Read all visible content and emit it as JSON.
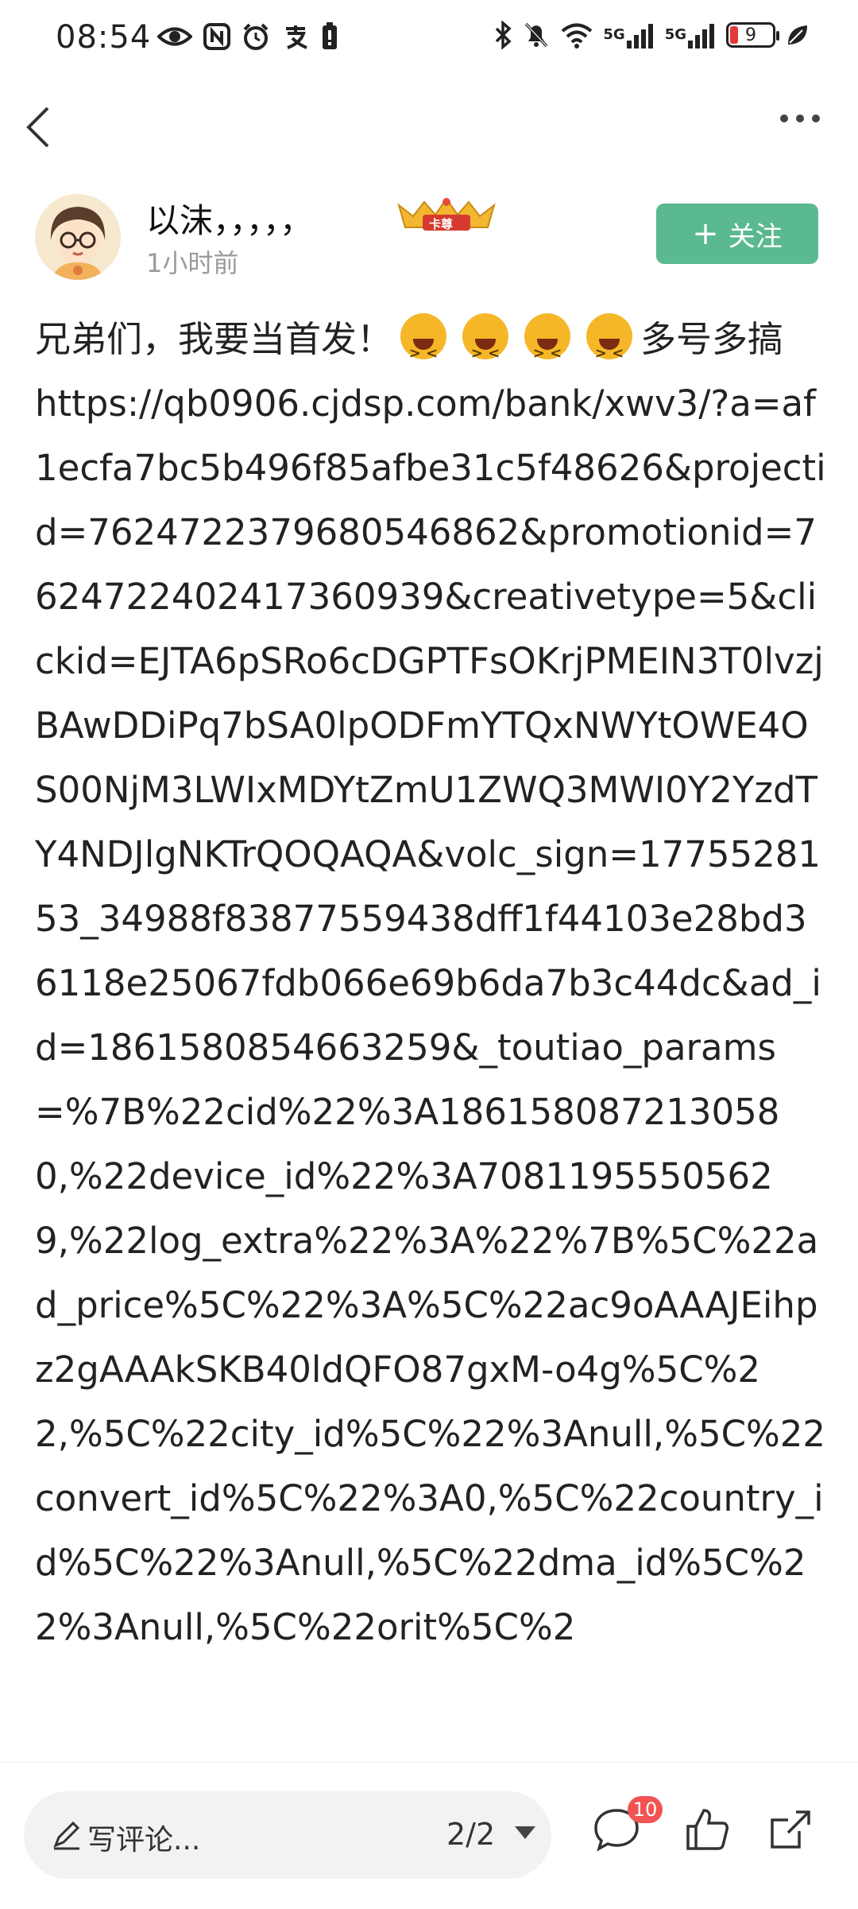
{
  "status_bar": {
    "time": "08:54",
    "signal_label_1": "5G",
    "signal_label_2": "5G",
    "battery": "9"
  },
  "author": {
    "name": "以沫，，，，，",
    "badge": "卡尊",
    "time_ago": "1小时前",
    "follow_label": "关注"
  },
  "post": {
    "text_prefix": "兄弟们，我要当首发！",
    "text_after_emoji": "多号多搞",
    "url": "https://qb0906.cjdsp.com/bank/xwv3/?a=af1ecfa7bc5b496f85afbe31c5f48626&projectid=7624722379680546862&promotionid=7624722402417360939&creativetype=5&clickid=EJTA6pSRo6cDGPTFsOKrjPMEIN3T0lvzjBAwDDiPq7bSA0lpODFmYTQxNWYtOWE4OS00NjM3LWIxMDYtZmU1ZWQ3MWI0Y2YzdTY4NDJlgNKTrQOQAQA&volc_sign=1775528153_34988f83877559438dff1f44103e28bd36118e25067fdb066e69b6da7b3c44dc&ad_id=1861580854663259&_toutiao_params=%7B%22cid%22%3A1861580872130580,%22device_id%22%3A70811955505629,%22log_extra%22%3A%22%7B%5C%22ad_price%5C%22%3A%5C%22ac9oAAAJEihpz2gAAAkSKB40ldQFO87gxM-o4g%5C%22,%5C%22city_id%5C%22%3Anull,%5C%22convert_id%5C%22%3A0,%5C%22country_id%5C%22%3Anull,%5C%22dma_id%5C%22%3Anull,%5C%22orit%5C%2"
  },
  "bottom_bar": {
    "comment_placeholder": "写评论...",
    "page_indicator": "2/2",
    "comment_count": "10"
  },
  "colors": {
    "accent": "#5ab98f",
    "badge_red": "#f25353"
  }
}
